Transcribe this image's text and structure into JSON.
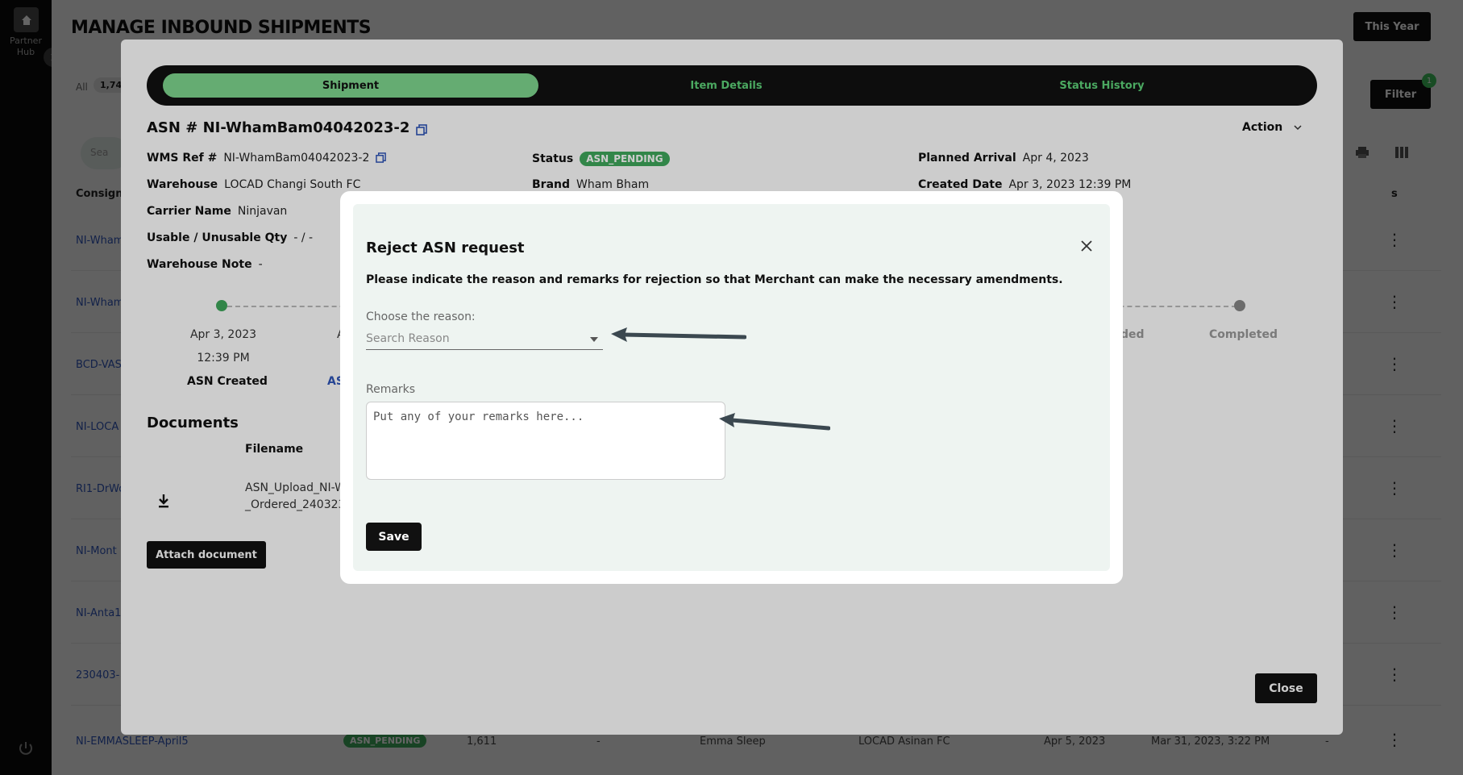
{
  "sidebar": {
    "hub_label_1": "Partner",
    "hub_label_2": "Hub"
  },
  "page": {
    "title": "MANAGE INBOUND SHIPMENTS",
    "date_filter": "This Year",
    "filter_label": "Filter",
    "filter_count": "1",
    "all_label": "All",
    "all_count": "1,74",
    "search_placeholder": "Sea",
    "col_consignee": "Consign",
    "col_last": "s",
    "rows": [
      {
        "link": "NI-Wham"
      },
      {
        "link": "NI-Wham"
      },
      {
        "link": "BCD-VAS"
      },
      {
        "link": "NI-LOCA"
      },
      {
        "link": "RI1-DrWo"
      },
      {
        "link": "NI-Mont"
      },
      {
        "link": "NI-Anta1"
      },
      {
        "link": "230403-"
      }
    ],
    "last_row": {
      "link": "NI-EMMASLEEP-April5",
      "status": "ASN_PENDING",
      "qty": "1,611",
      "dash1": "-",
      "brand": "Emma Sleep",
      "warehouse": "LOCAD Asinan FC",
      "arrival": "Apr 5, 2023",
      "created": "Mar 31, 2023, 3:22 PM",
      "dash2": "-"
    }
  },
  "shipment_modal": {
    "tabs": [
      {
        "label": "Shipment",
        "active": true
      },
      {
        "label": "Item Details",
        "active": false
      },
      {
        "label": "Status History",
        "active": false
      }
    ],
    "asn_title": "ASN # NI-WhamBam04042023-2",
    "action_label": "Action",
    "fields": {
      "wms_ref_label": "WMS Ref #",
      "wms_ref_value": "NI-WhamBam04042023-2",
      "warehouse_label": "Warehouse",
      "warehouse_value": "LOCAD Changi South FC",
      "carrier_label": "Carrier Name",
      "carrier_value": "Ninjavan",
      "qty_label": "Usable / Unusable Qty",
      "qty_value": "- / -",
      "note_label": "Warehouse Note",
      "note_value": "-",
      "status_label": "Status",
      "status_value": "ASN_PENDING",
      "brand_label": "Brand",
      "brand_value": "Wham Bham",
      "arrival_label": "Planned Arrival",
      "arrival_value": "Apr 4, 2023",
      "created_label": "Created Date",
      "created_value": "Apr 3, 2023 12:39 PM"
    },
    "timeline": {
      "first_date": "Apr 3, 2023",
      "first_time": "12:39 PM",
      "first_label": "ASN Created",
      "second_partial": "A",
      "second_label_partial": "AS",
      "received_partial": "ded",
      "last_label": "Completed"
    },
    "documents": {
      "title": "Documents",
      "header_filename": "Filename",
      "file_line1": "ASN_Upload_NI-W",
      "file_line2": "_Ordered_240323",
      "attach_label": "Attach document"
    },
    "close_label": "Close"
  },
  "reject_modal": {
    "title": "Reject ASN request",
    "subtitle": "Please indicate the reason and remarks for rejection so that Merchant can make the necessary amendments.",
    "reason_label": "Choose the reason:",
    "reason_placeholder": "Search Reason",
    "remarks_label": "Remarks",
    "remarks_placeholder": "Put any of your remarks here...",
    "save_label": "Save"
  },
  "colors": {
    "accent_green": "#5ed47a",
    "status_green": "#3fa85c",
    "link_blue": "#2f55b8",
    "dark": "#111111"
  }
}
